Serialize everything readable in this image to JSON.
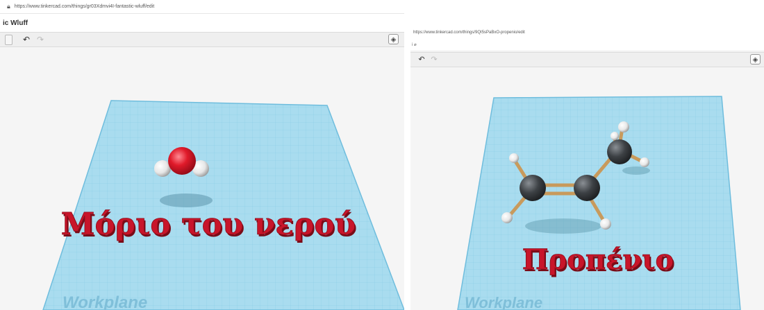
{
  "left": {
    "url": "https://www.tinkercad.com/things/gr03Xdmvi4I-fantastic-wluff/edit",
    "title": "ic Wluff",
    "toolbar": {
      "undo": "↶",
      "redo": "↷",
      "view_icon": "view-cube-icon"
    },
    "label_text": "Μόριο του νερού",
    "workplane_label": "Workplane"
  },
  "right": {
    "url": "https://www.tinkercad.com/things/9QI5sPaBxO-propenio/edit",
    "title": "i ⌀",
    "toolbar": {
      "undo": "↶",
      "redo": "↷",
      "view_icon": "view-cube-icon"
    },
    "label_text": "Προπένιο",
    "workplane_label": "Workplane"
  },
  "colors": {
    "grid_fill": "#a8dcef",
    "grid_line": "#7cc6e4",
    "label_red": "#c8152a",
    "oxygen": "#e01a2a",
    "hydrogen": "#f2f2f2",
    "carbon": "#3d4145",
    "bond": "#c89a5c"
  }
}
